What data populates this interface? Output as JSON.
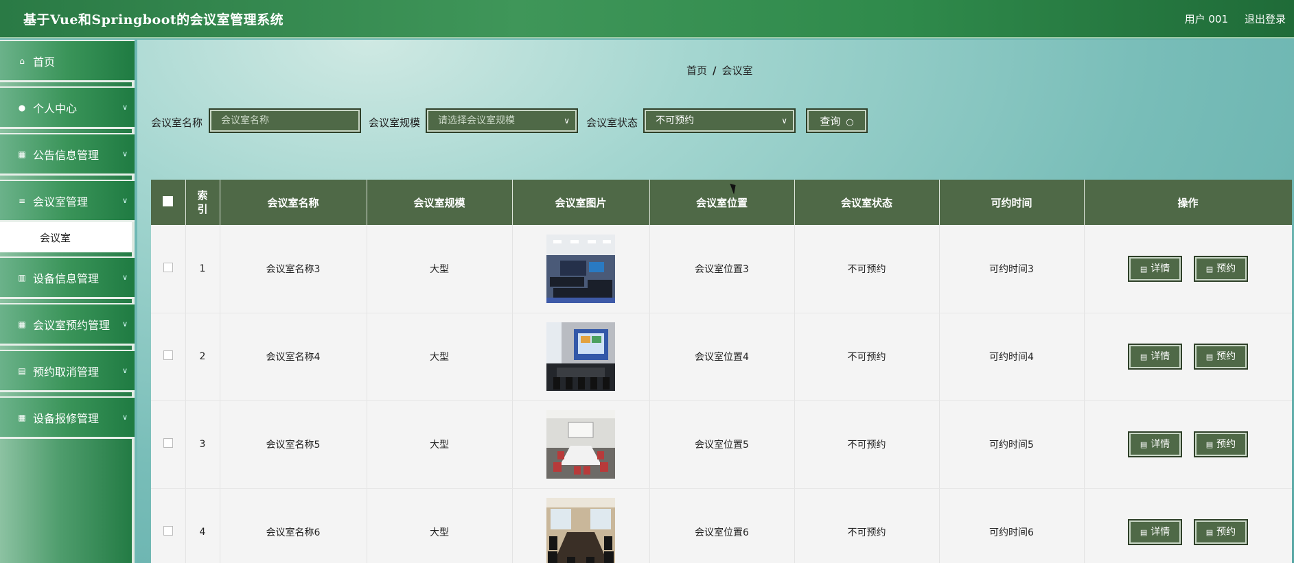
{
  "header": {
    "title": "基于Vue和Springboot的会议室管理系统",
    "user": "用户 001",
    "logout": "退出登录"
  },
  "sidebar": {
    "items": [
      {
        "label": "首页",
        "icon": "home-icon"
      },
      {
        "label": "个人中心",
        "icon": "user-icon"
      },
      {
        "label": "公告信息管理",
        "icon": "grid-icon"
      },
      {
        "label": "会议室管理",
        "icon": "list-icon"
      },
      {
        "label": "设备信息管理",
        "icon": "chart-icon"
      },
      {
        "label": "会议室预约管理",
        "icon": "grid-icon"
      },
      {
        "label": "预约取消管理",
        "icon": "clipboard-icon"
      },
      {
        "label": "设备报修管理",
        "icon": "grid-icon"
      }
    ],
    "submenu": "会议室"
  },
  "breadcrumb": {
    "home": "首页",
    "sep": "/",
    "current": "会议室"
  },
  "search": {
    "name_label": "会议室名称",
    "name_placeholder": "会议室名称",
    "scale_label": "会议室规模",
    "scale_placeholder": "请选择会议室规模",
    "status_label": "会议室状态",
    "status_value": "不可预约",
    "query_label": "查询"
  },
  "table": {
    "headers": [
      "索引",
      "会议室名称",
      "会议室规模",
      "会议室图片",
      "会议室位置",
      "会议室状态",
      "可约时间",
      "操作"
    ],
    "detail_label": "详情",
    "reserve_label": "预约",
    "rows": [
      {
        "index": "1",
        "name": "会议室名称3",
        "scale": "大型",
        "location": "会议室位置3",
        "status": "不可预约",
        "time": "可约时间3"
      },
      {
        "index": "2",
        "name": "会议室名称4",
        "scale": "大型",
        "location": "会议室位置4",
        "status": "不可预约",
        "time": "可约时间4"
      },
      {
        "index": "3",
        "name": "会议室名称5",
        "scale": "大型",
        "location": "会议室位置5",
        "status": "不可预约",
        "time": "可约时间5"
      },
      {
        "index": "4",
        "name": "会议室名称6",
        "scale": "大型",
        "location": "会议室位置6",
        "status": "不可预约",
        "time": "可约时间6"
      }
    ]
  },
  "colors": {
    "header": "#2f8a4b",
    "button": "#4f6947",
    "accent_teal": "#78bdb8"
  }
}
